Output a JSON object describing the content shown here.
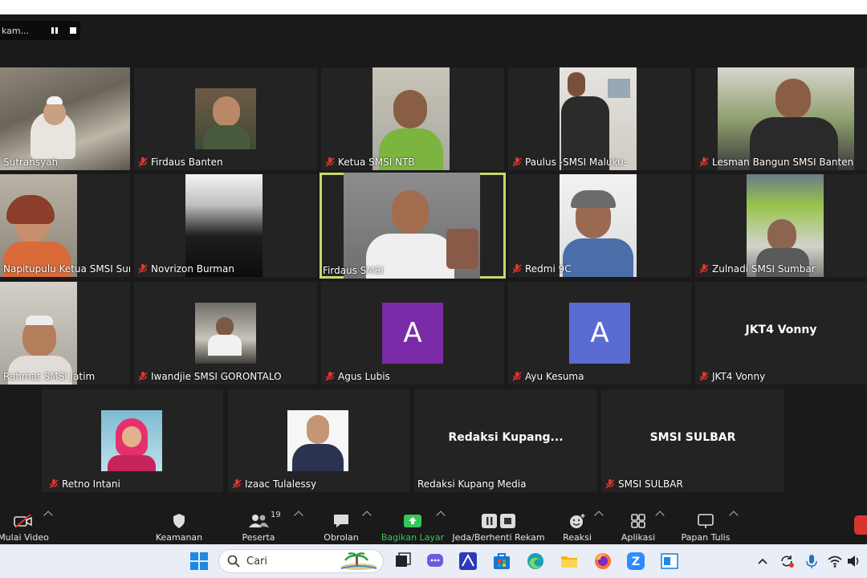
{
  "recording": {
    "label": "kam..."
  },
  "participants": {
    "sutransyah": "Sutransyah",
    "firdaus_banten": "Firdaus Banten",
    "ketua_ntb": "Ketua SMSI NTB",
    "paulus": "Paulus -SMSI Maluku-",
    "lesman": "Lesman Bangun SMSI Banten",
    "napitupulu": "Napitupulu Ketua SMSI Sumut",
    "novrizon": "Novrizon Burman",
    "firdaus_smsi": "Firdaus SMSI",
    "redmi": "Redmi 9C",
    "zulnadi": "Zulnadi SMSI Sumbar",
    "rahmat": "Rahmat SMSI Jatim",
    "iwandjie": "Iwandjie SMSI GORONTALO",
    "agus": "Agus Lubis",
    "ayu": "Ayu Kesuma",
    "jkt4": "JKT4 Vonny",
    "retno": "Retno Intani",
    "izaac": "Izaac Tulalessy",
    "redaksi": "Redaksi Kupang Media",
    "sulbar": "SMSI SULBAR"
  },
  "avatars": {
    "agus": "A",
    "ayu": "A"
  },
  "placeholders": {
    "jkt4": "JKT4 Vonny",
    "redaksi": "Redaksi  Kupang...",
    "sulbar": "SMSI SULBAR"
  },
  "toolbar": {
    "video": "Mulai Video",
    "security": "Keamanan",
    "participants": "Peserta",
    "participants_count": "19",
    "chat": "Obrolan",
    "share": "Bagikan Layar",
    "record": "Jeda/Berhenti Rekam",
    "reactions": "Reaksi",
    "apps": "Aplikasi",
    "whiteboard": "Papan Tulis"
  },
  "taskbar": {
    "search_label": "Cari"
  },
  "colors": {
    "active_border": "#c6d96a",
    "avatar_purple": "#7b2aa8",
    "avatar_blue": "#5a6bd1",
    "share_green": "#34c759",
    "muted_red": "#e3362f"
  }
}
